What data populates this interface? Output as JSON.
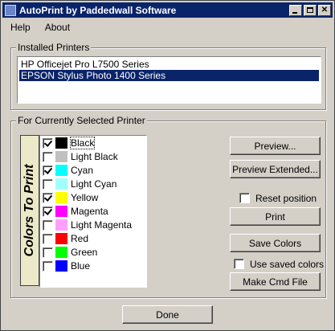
{
  "window": {
    "title": "AutoPrint by Paddedwall Software"
  },
  "menu": {
    "help": "Help",
    "about": "About"
  },
  "installed": {
    "label": "Installed Printers",
    "printers": [
      {
        "name": "HP Officejet Pro L7500 Series",
        "selected": false
      },
      {
        "name": "EPSON Stylus Photo 1400 Series",
        "selected": true
      }
    ]
  },
  "selected_printer": {
    "label": "For Currently Selected Printer",
    "colors_title": "Colors To Print",
    "colors": [
      {
        "name": "Black",
        "checked": true,
        "swatch": "#000000"
      },
      {
        "name": "Light Black",
        "checked": false,
        "swatch": "#c0c0c0"
      },
      {
        "name": "Cyan",
        "checked": true,
        "swatch": "#00ffff"
      },
      {
        "name": "Light Cyan",
        "checked": false,
        "swatch": "#a0ffff"
      },
      {
        "name": "Yellow",
        "checked": true,
        "swatch": "#ffff00"
      },
      {
        "name": "Magenta",
        "checked": true,
        "swatch": "#ff00ff"
      },
      {
        "name": "Light Magenta",
        "checked": false,
        "swatch": "#ffa0ff"
      },
      {
        "name": "Red",
        "checked": false,
        "swatch": "#ff0000"
      },
      {
        "name": "Green",
        "checked": false,
        "swatch": "#00ff00"
      },
      {
        "name": "Blue",
        "checked": false,
        "swatch": "#0000ff"
      }
    ],
    "preview_label": "Preview...",
    "preview_extended_label": "Preview Extended...",
    "reset_position_label": "Reset position",
    "print_label": "Print",
    "save_colors_label": "Save Colors",
    "use_saved_colors_label": "Use saved colors",
    "make_cmd_file_label": "Make Cmd File"
  },
  "done_label": "Done",
  "colors": {
    "titlebar": "#0a246a",
    "face": "#d4d0c8",
    "selection": "#0a246a"
  }
}
